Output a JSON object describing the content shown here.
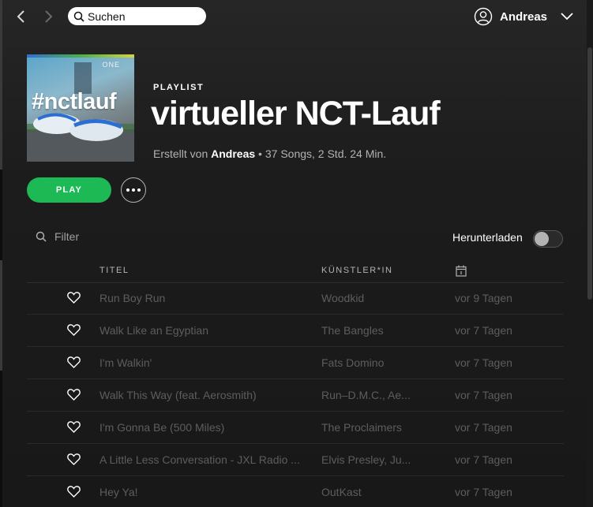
{
  "topbar": {
    "search_placeholder": "Suchen",
    "user_name": "Andreas"
  },
  "playlist": {
    "cover_text": "#nctlauf",
    "cover_brand": "ONE",
    "kind": "PLAYLIST",
    "title": "virtueller NCT-Lauf",
    "meta_prefix": "Erstellt von ",
    "owner": "Andreas",
    "meta_suffix": " • 37 Songs, 2 Std. 24 Min.",
    "play_label": "PLAY"
  },
  "controls": {
    "filter_placeholder": "Filter",
    "download_label": "Herunterladen",
    "download_enabled": false
  },
  "table": {
    "col_title": "TITEL",
    "col_artist": "KÜNSTLER*IN",
    "col_date_icon": "calendar-icon",
    "rows": [
      {
        "title": "Run Boy Run",
        "artist": "Woodkid",
        "added": "vor 9 Tagen"
      },
      {
        "title": "Walk Like an Egyptian",
        "artist": "The Bangles",
        "added": "vor 7 Tagen"
      },
      {
        "title": "I'm Walkin'",
        "artist": "Fats Domino",
        "added": "vor 7 Tagen"
      },
      {
        "title": "Walk This Way (feat. Aerosmith)",
        "artist": "Run–D.M.C., Ae...",
        "added": "vor 7 Tagen"
      },
      {
        "title": "I'm Gonna Be (500 Miles)",
        "artist": "The Proclaimers",
        "added": "vor 7 Tagen"
      },
      {
        "title": "A Little Less Conversation - JXL Radio ...",
        "artist": "Elvis Presley, Ju...",
        "added": "vor 7 Tagen"
      },
      {
        "title": "Hey Ya!",
        "artist": "OutKast",
        "added": "vor 7 Tagen"
      }
    ]
  },
  "colors": {
    "accent": "#1db954",
    "background": "#181818",
    "muted_text": "#5d5d5d"
  }
}
